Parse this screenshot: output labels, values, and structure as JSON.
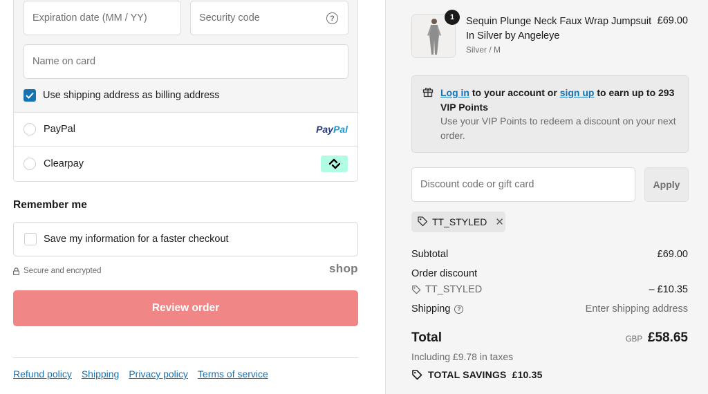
{
  "payment": {
    "expiration_placeholder": "Expiration date (MM / YY)",
    "security_placeholder": "Security code",
    "name_placeholder": "Name on card",
    "billing_label": "Use shipping address as billing address",
    "options": [
      {
        "label": "PayPal",
        "logo_text_1": "Pay",
        "logo_text_2": "Pal"
      },
      {
        "label": "Clearpay"
      }
    ]
  },
  "remember": {
    "title": "Remember me",
    "save_label": "Save my information for a faster checkout"
  },
  "secure_text": "Secure and encrypted",
  "shop_logo": "shop",
  "review_button": "Review order",
  "footer_links": [
    "Refund policy",
    "Shipping",
    "Privacy policy",
    "Terms of service"
  ],
  "product": {
    "name": "Sequin Plunge Neck Faux Wrap Jumpsuit In Silver by Angeleye",
    "variant": "Silver / M",
    "price": "£69.00",
    "quantity": "1"
  },
  "vip": {
    "login_link": "Log in",
    "mid_text": " to your account or ",
    "signup_link": "sign up",
    "end_text": " to earn up to 293 VIP Points",
    "description": "Use your VIP Points to redeem a discount on your next order."
  },
  "discount": {
    "placeholder": "Discount code or gift card",
    "apply_label": "Apply",
    "applied_code": "TT_STYLED"
  },
  "summary": {
    "subtotal_label": "Subtotal",
    "subtotal_value": "£69.00",
    "order_discount_label": "Order discount",
    "discount_code": "TT_STYLED",
    "discount_value": "– £10.35",
    "shipping_label": "Shipping",
    "shipping_value": "Enter shipping address",
    "total_label": "Total",
    "currency": "GBP",
    "total_value": "£58.65",
    "taxes_text": "Including £9.78 in taxes",
    "savings_label": "TOTAL SAVINGS",
    "savings_value": "£10.35"
  },
  "colors": {
    "accent": "#1773b0",
    "review_button_bg": "#f08686",
    "clearpay_bg": "#b2fce4"
  }
}
